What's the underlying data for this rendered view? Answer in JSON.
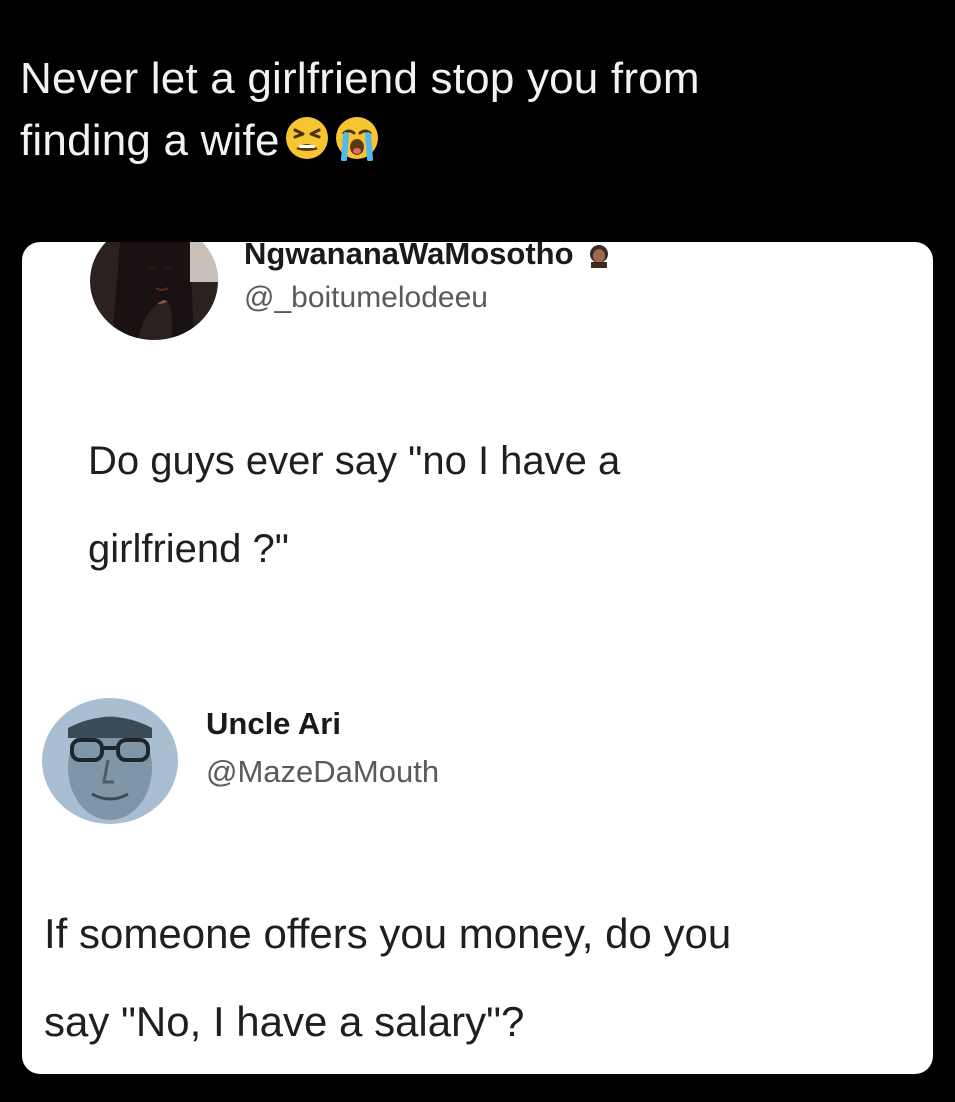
{
  "post": {
    "caption_line1": "Never let a girlfriend stop you from",
    "caption_line2": "finding a wife",
    "caption_emojis": [
      "tired-face-emoji",
      "loudly-crying-face-emoji"
    ]
  },
  "screenshot": {
    "tweet1": {
      "display_name": "NgwananaWaMosotho",
      "handle": "@_boitumelodeeu",
      "text_line1": "Do guys ever say \"no I have a",
      "text_line2": "girlfriend ?\""
    },
    "tweet2": {
      "display_name": "Uncle Ari",
      "handle": "@MazeDaMouth",
      "text_line1": "If someone offers you money, do you",
      "text_line2": "say \"No, I have a salary\"?"
    }
  }
}
